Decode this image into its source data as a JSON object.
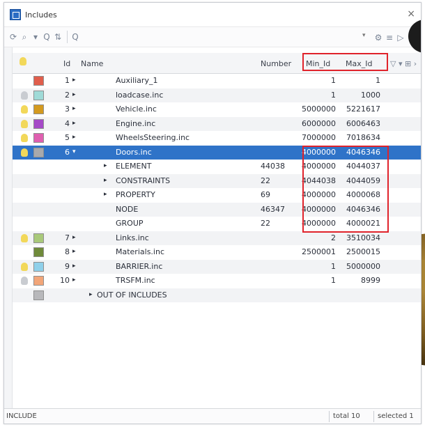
{
  "window": {
    "title": "Includes",
    "close": "×"
  },
  "toolbar": {
    "icons": [
      "refresh-icon",
      "filter-icon",
      "search-icon",
      "sort-icon",
      "find-icon"
    ],
    "dropdown": "▾",
    "right_icons": [
      "settings-icon",
      "list-icon",
      "extra-icon"
    ]
  },
  "columns": {
    "visibility": "",
    "id": "Id",
    "name": "Name",
    "number": "Number",
    "min_id": "Min_Id",
    "max_id": "Max_Id",
    "tools": "▽ ▾ ⊞ ›"
  },
  "rows": [
    {
      "bulb": "none",
      "color": "#e05e4c",
      "id": "1",
      "arrow": "▸",
      "name": "Auxiliary_1",
      "number": "",
      "min": "1",
      "max": "1"
    },
    {
      "bulb": "off",
      "color": "#9fdad7",
      "id": "2",
      "arrow": "▸",
      "name": "loadcase.inc",
      "number": "",
      "min": "1",
      "max": "1000"
    },
    {
      "bulb": "on",
      "color": "#d49a1f",
      "id": "3",
      "arrow": "▸",
      "name": "Vehicle.inc",
      "number": "",
      "min": "5000000",
      "max": "5221617"
    },
    {
      "bulb": "on",
      "color": "#a549c7",
      "id": "4",
      "arrow": "▸",
      "name": "Engine.inc",
      "number": "",
      "min": "6000000",
      "max": "6006463"
    },
    {
      "bulb": "on",
      "color": "#df5fb0",
      "id": "5",
      "arrow": "▸",
      "name": "WheelsSteering.inc",
      "number": "",
      "min": "7000000",
      "max": "7018634"
    },
    {
      "bulb": "on",
      "color": "#a9a9ac",
      "id": "6",
      "arrow": "▾",
      "name": "Doors.inc",
      "number": "",
      "min": "4000000",
      "max": "4046346",
      "selected": true
    },
    {
      "bulb": "none",
      "color": "",
      "id": "",
      "arrow": "▸",
      "name": "ELEMENT",
      "number": "44038",
      "min": "4000000",
      "max": "4044037",
      "child": true
    },
    {
      "bulb": "none",
      "color": "",
      "id": "",
      "arrow": "▸",
      "name": "CONSTRAINTS",
      "number": "22",
      "min": "4044038",
      "max": "4044059",
      "child": true
    },
    {
      "bulb": "none",
      "color": "",
      "id": "",
      "arrow": "▸",
      "name": "PROPERTY",
      "number": "69",
      "min": "4000000",
      "max": "4000068",
      "child": true
    },
    {
      "bulb": "none",
      "color": "",
      "id": "",
      "arrow": "",
      "name": "NODE",
      "number": "46347",
      "min": "4000000",
      "max": "4046346",
      "child": true
    },
    {
      "bulb": "none",
      "color": "",
      "id": "",
      "arrow": "",
      "name": "GROUP",
      "number": "22",
      "min": "4000000",
      "max": "4000021",
      "child": true
    },
    {
      "bulb": "on",
      "color": "#a9c97a",
      "id": "7",
      "arrow": "▸",
      "name": "Links.inc",
      "number": "",
      "min": "2",
      "max": "3510034"
    },
    {
      "bulb": "none",
      "color": "#6f8a3a",
      "id": "8",
      "arrow": "▸",
      "name": "Materials.inc",
      "number": "",
      "min": "2500001",
      "max": "2500015"
    },
    {
      "bulb": "on",
      "color": "#8fd0ea",
      "id": "9",
      "arrow": "▸",
      "name": "BARRIER.inc",
      "number": "",
      "min": "1",
      "max": "5000000"
    },
    {
      "bulb": "off",
      "color": "#f2a679",
      "id": "10",
      "arrow": "▸",
      "name": "TRSFM.inc",
      "number": "",
      "min": "1",
      "max": "8999"
    },
    {
      "bulb": "none",
      "color": "#b8b8bb",
      "id": "",
      "arrow": "▸",
      "name": "OUT OF INCLUDES",
      "number": "",
      "min": "",
      "max": ""
    }
  ],
  "status": {
    "left": "INCLUDE",
    "total": "total 10",
    "selected": "selected 1"
  },
  "colors": {
    "selection": "#2f73c8",
    "highlight_box": "#e0232b"
  }
}
